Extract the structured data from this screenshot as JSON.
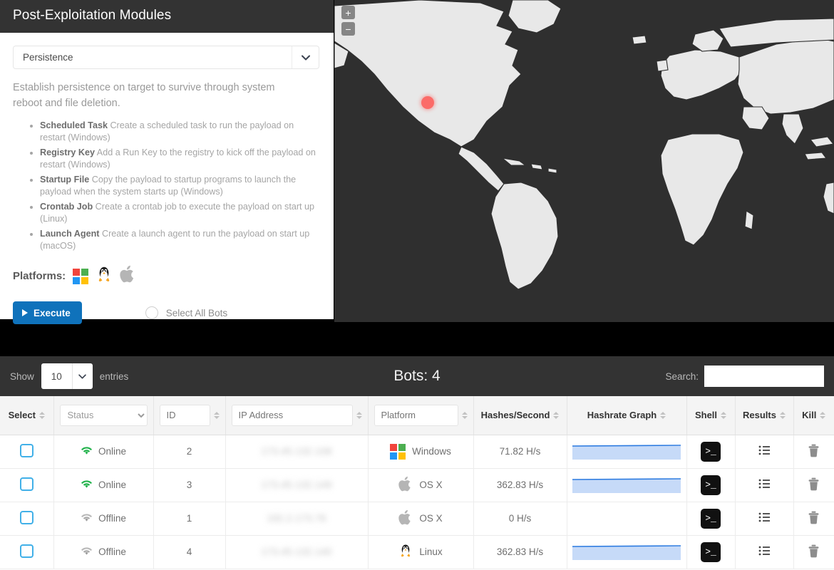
{
  "module_panel": {
    "title": "Post-Exploitation Modules",
    "selected_module": "Persistence",
    "caret_icon": "chevron-down-icon",
    "description": "Establish persistence on target to survive through system reboot and file deletion.",
    "items": [
      {
        "term": "Scheduled Task",
        "text": " Create a scheduled task to run the payload on restart (Windows)"
      },
      {
        "term": "Registry Key",
        "text": " Add a Run Key to the registry to kick off the payload on restart (Windows)"
      },
      {
        "term": "Startup File",
        "text": " Copy the payload to startup programs to launch the payload when the system starts up (Windows)"
      },
      {
        "term": "Crontab Job",
        "text": " Create a crontab job to execute the payload on start up (Linux)"
      },
      {
        "term": "Launch Agent",
        "text": " Create a launch agent to run the payload on start up (macOS)"
      }
    ],
    "platforms_label": "Platforms:",
    "platform_icons": [
      "windows-icon",
      "linux-icon",
      "apple-icon"
    ],
    "execute_label": "Execute",
    "select_all_label": "Select All Bots"
  },
  "map": {
    "zoom_in_label": "+",
    "zoom_out_label": "−",
    "marker_color": "#fb6b68",
    "ocean_color": "#2f2f2f",
    "land_color": "#e8e8e8"
  },
  "table_toolbar": {
    "show_label": "Show",
    "entries_value": "10",
    "entries_label": "entries",
    "title": "Bots: 4",
    "search_label": "Search:",
    "search_value": "",
    "search_placeholder": ""
  },
  "table": {
    "columns": [
      {
        "key": "select",
        "label": "Select",
        "type": "text"
      },
      {
        "key": "status",
        "label": "Status",
        "type": "select",
        "placeholder": "Status"
      },
      {
        "key": "id",
        "label": "ID",
        "type": "input",
        "placeholder": "ID"
      },
      {
        "key": "ip",
        "label": "IP Address",
        "type": "input",
        "placeholder": "IP Address"
      },
      {
        "key": "platform",
        "label": "Platform",
        "type": "input",
        "placeholder": "Platform"
      },
      {
        "key": "hashes",
        "label": "Hashes/Second",
        "type": "text"
      },
      {
        "key": "graph",
        "label": "Hashrate Graph",
        "type": "text"
      },
      {
        "key": "shell",
        "label": "Shell",
        "type": "text"
      },
      {
        "key": "results",
        "label": "Results",
        "type": "text"
      },
      {
        "key": "kill",
        "label": "Kill",
        "type": "text"
      }
    ],
    "rows": [
      {
        "status": "Online",
        "id": "2",
        "ip": "173.45.132.108",
        "platform": "Windows",
        "platform_icon": "windows-icon",
        "hashes": "71.82 H/s",
        "graph": true
      },
      {
        "status": "Online",
        "id": "3",
        "ip": "173.45.132.149",
        "platform": "OS X",
        "platform_icon": "apple-icon",
        "hashes": "362.83 H/s",
        "graph": true
      },
      {
        "status": "Offline",
        "id": "1",
        "ip": "192.2.173.76",
        "platform": "OS X",
        "platform_icon": "apple-icon",
        "hashes": "0 H/s",
        "graph": false
      },
      {
        "status": "Offline",
        "id": "4",
        "ip": "173.45.132.140",
        "platform": "Linux",
        "platform_icon": "linux-icon",
        "hashes": "362.83 H/s",
        "graph": true
      }
    ],
    "icons": {
      "shell": "terminal-icon",
      "results": "list-icon",
      "kill": "trash-icon",
      "online": "wifi-icon",
      "offline": "wifi-off-icon"
    },
    "colors": {
      "online": "#21b24b",
      "offline": "#9b9b9b",
      "graph_fill": "#c6daf8",
      "graph_line": "#2b7ae0",
      "checkbox": "#41b0e8"
    }
  }
}
